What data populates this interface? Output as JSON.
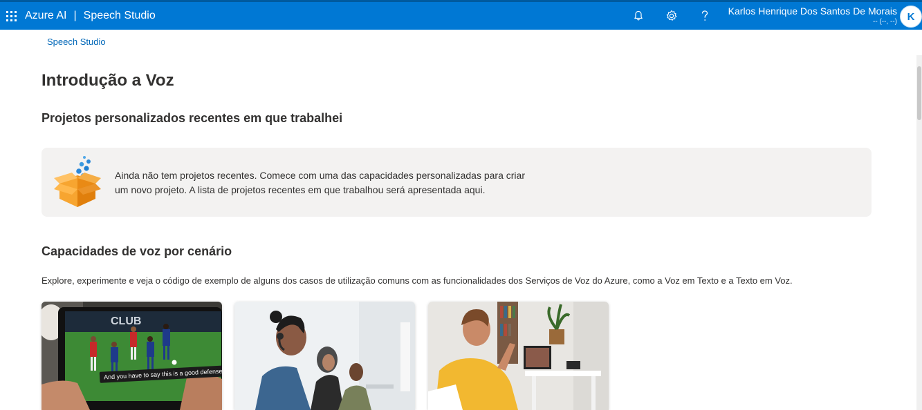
{
  "header": {
    "brand": "Azure AI",
    "separator": "|",
    "product": "Speech Studio",
    "icons": [
      "bell-icon",
      "gear-icon",
      "help-icon"
    ],
    "user_name": "Karlos Henrique Dos Santos De Morais",
    "user_sub": "-- (--, --)",
    "avatar_initial": "K",
    "bar_color": "#0078d4"
  },
  "breadcrumb": "Speech Studio",
  "page_title": "Introdução a Voz",
  "recent": {
    "title": "Projetos personalizados recentes em que trabalhei",
    "empty_line1": "Ainda não tem projetos recentes. Comece com uma das capacidades personalizadas para criar",
    "empty_line2": "um novo projeto. A lista de projetos recentes em que trabalhou será apresentada aqui."
  },
  "capabilities": {
    "title": "Capacidades de voz por cenário",
    "description": "Explore, experimente e veja o código de exemplo de alguns dos casos de utilização comuns com as funcionalidades dos Serviços de Voz do Azure, como a Voz em Texto e a Texto em Voz.",
    "cards": [
      {
        "caption": "And you have to say this is a good defense."
      },
      {
        "caption": ""
      },
      {
        "caption": ""
      }
    ]
  }
}
